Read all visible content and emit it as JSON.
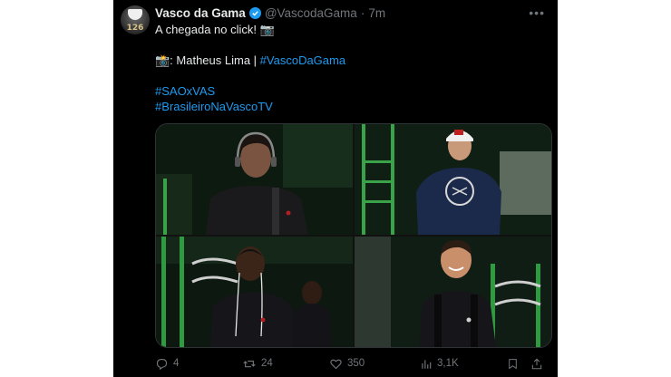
{
  "tweet": {
    "author_name": "Vasco da Gama",
    "handle": "@VascodaGama",
    "separator": "·",
    "time": "7m",
    "avatar_text": "126",
    "text_line1": "A chegada no click! 📷",
    "credit_prefix": "📸: Matheus Lima | ",
    "credit_hashtag": "#VascoDaGama",
    "hashtag1": "#SAOxVAS",
    "hashtag2": "#BrasileiroNaVascoTV",
    "link_color": "#1d9bf0"
  },
  "actions": {
    "replies": "4",
    "retweets": "24",
    "likes": "350",
    "views": "3,1K"
  }
}
